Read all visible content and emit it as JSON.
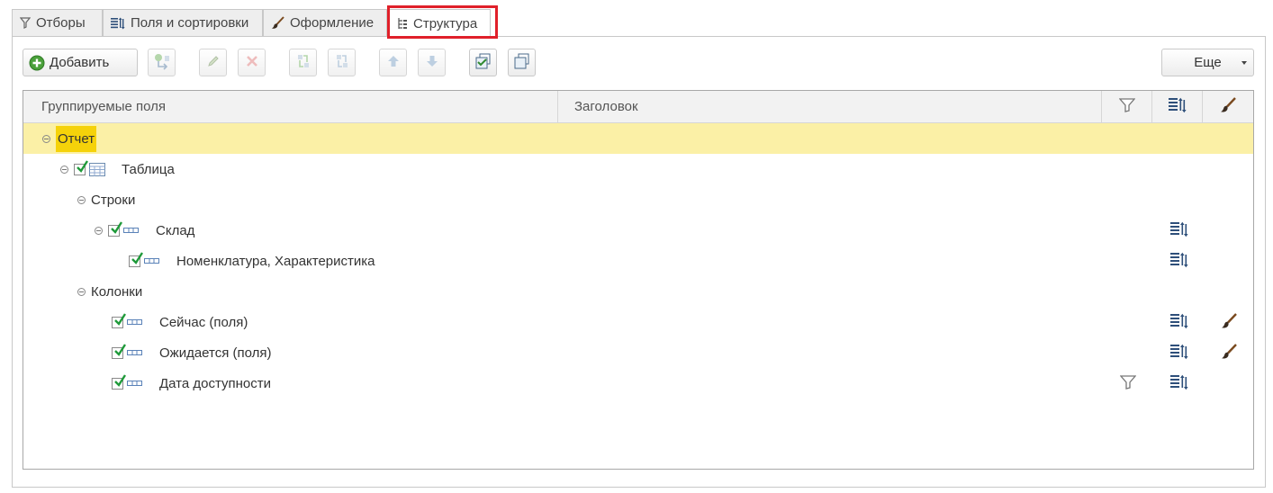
{
  "tabs": [
    {
      "label": "Отборы",
      "icon": "filter-icon"
    },
    {
      "label": "Поля и сортировки",
      "icon": "fields-sort-icon"
    },
    {
      "label": "Оформление",
      "icon": "brush-icon"
    },
    {
      "label": "Структура",
      "icon": "structure-icon",
      "active": true
    }
  ],
  "toolbar": {
    "add_label": "Добавить",
    "more_label": "Еще"
  },
  "grid": {
    "columns": [
      "Группируемые поля",
      "Заголовок"
    ],
    "column_icons": [
      "filter-icon",
      "fields-sort-icon",
      "brush-icon"
    ],
    "rows": [
      {
        "label": "Отчет",
        "selected": true
      },
      {
        "label": "Таблица",
        "checked": true
      },
      {
        "label": "Строки"
      },
      {
        "label": "Склад",
        "checked": true,
        "has_fields": true
      },
      {
        "label": "Номенклатура, Характеристика",
        "checked": true,
        "has_fields": true
      },
      {
        "label": "Колонки"
      },
      {
        "label": "Сейчас (поля)",
        "checked": true,
        "has_fields": true,
        "has_style": true
      },
      {
        "label": "Ожидается (поля)",
        "checked": true,
        "has_fields": true,
        "has_style": true
      },
      {
        "label": "Дата доступности",
        "checked": true,
        "has_filter": true,
        "has_fields": true
      }
    ]
  },
  "colors": {
    "selection_row": "#fbf0a6",
    "selection_text": "#f5d20a",
    "highlight": "#e0202a",
    "check": "#1f9a3a"
  }
}
